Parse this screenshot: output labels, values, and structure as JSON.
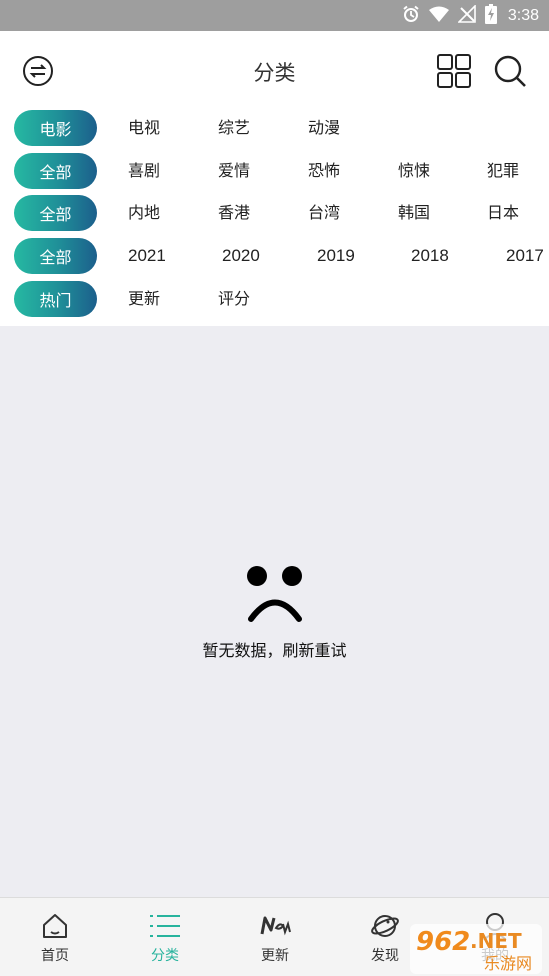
{
  "status_bar": {
    "time": "3:38",
    "icons": [
      "alarm-icon",
      "wifi-icon",
      "no-signal-icon",
      "battery-charging-icon"
    ]
  },
  "header": {
    "title": "分类",
    "left_icon": "switch-arrows-icon",
    "right_icons": [
      "grid-icon",
      "search-icon"
    ]
  },
  "filters": [
    {
      "selected": "电影",
      "options": [
        "电视",
        "综艺",
        "动漫"
      ]
    },
    {
      "selected": "全部",
      "options": [
        "喜剧",
        "爱情",
        "恐怖",
        "惊悚",
        "犯罪"
      ]
    },
    {
      "selected": "全部",
      "options": [
        "内地",
        "香港",
        "台湾",
        "韩国",
        "日本"
      ]
    },
    {
      "selected": "全部",
      "options": [
        "2021",
        "2020",
        "2019",
        "2018",
        "2017"
      ]
    },
    {
      "selected": "热门",
      "options": [
        "更新",
        "评分"
      ]
    }
  ],
  "empty_state": {
    "icon": "sad-face-icon",
    "message": "暂无数据，刷新重试"
  },
  "bottom_nav": [
    {
      "label": "首页",
      "icon": "home-icon",
      "active": false
    },
    {
      "label": "分类",
      "icon": "list-icon",
      "active": true
    },
    {
      "label": "更新",
      "icon": "new-badge-icon",
      "active": false
    },
    {
      "label": "发现",
      "icon": "planet-icon",
      "active": false
    },
    {
      "label": "我的",
      "icon": "user-icon",
      "active": false
    }
  ],
  "colors": {
    "accent": "#27b39d",
    "pill_gradient_start": "#26b9a2",
    "pill_gradient_end": "#1c5f8c",
    "status_bar": "#9e9e9e",
    "background": "#ededf2"
  },
  "watermark": {
    "logo_text": "962.NET",
    "site_text": "乐游网"
  }
}
